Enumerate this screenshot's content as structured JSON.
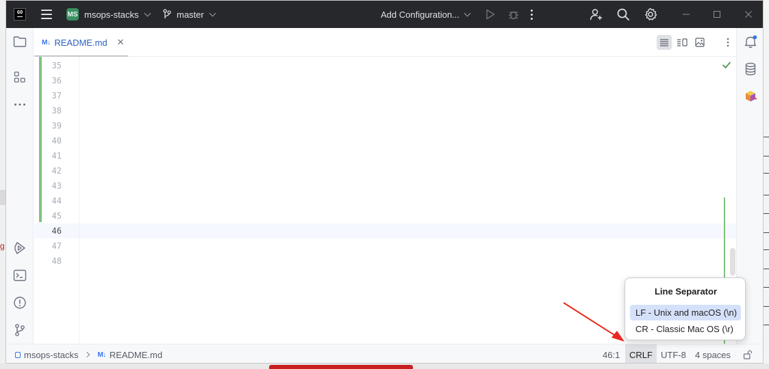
{
  "window": {
    "project": {
      "badge": "MS",
      "name": "msops-stacks"
    },
    "branch": "master",
    "run_configuration": "Add Configuration..."
  },
  "editor": {
    "tab": {
      "label": "README.md",
      "icon": "M↓"
    },
    "line_numbers": [
      "35",
      "36",
      "37",
      "38",
      "39",
      "40",
      "41",
      "42",
      "43",
      "44",
      "45",
      "46",
      "47",
      "48"
    ],
    "current_line": "46"
  },
  "status_bar": {
    "breadcrumb": [
      "msops-stacks",
      "README.md"
    ],
    "caret_position": "46:1",
    "line_separator": "CRLF",
    "encoding": "UTF-8",
    "indent": "4 spaces"
  },
  "popup": {
    "title": "Line Separator",
    "options": [
      "LF - Unix and macOS (\\n)",
      "CR - Classic Mac OS (\\r)"
    ]
  },
  "background": {
    "left_fragment": "g"
  },
  "colors": {
    "titlebar": "#27282c",
    "accent": "#3574f0",
    "vcs_added": "#7fc27f",
    "selection": "#d5e1fb",
    "annotation_arrow": "#e8291c"
  }
}
